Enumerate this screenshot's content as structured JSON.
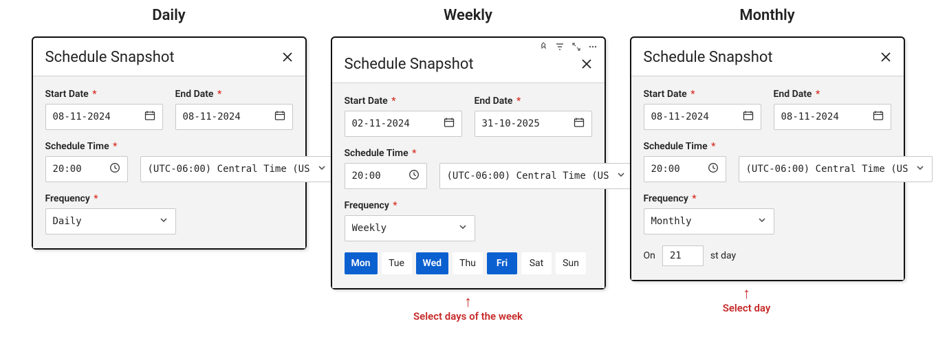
{
  "sections": {
    "daily": {
      "title": "Daily"
    },
    "weekly": {
      "title": "Weekly",
      "annotation": "Select days of the week"
    },
    "monthly": {
      "title": "Monthly",
      "annotation": "Select day"
    }
  },
  "dialog": {
    "title": "Schedule Snapshot",
    "labels": {
      "start_date": "Start Date",
      "end_date": "End Date",
      "schedule_time": "Schedule Time",
      "frequency": "Frequency",
      "required_mark": "*"
    }
  },
  "daily": {
    "start_date": "08-11-2024",
    "end_date": "08-11-2024",
    "time": "20:00",
    "tz": "(UTC-06:00) Central Time (US",
    "frequency": "Daily"
  },
  "weekly": {
    "start_date": "02-11-2024",
    "end_date": "31-10-2025",
    "time": "20:00",
    "tz": "(UTC-06:00) Central Time (US",
    "frequency": "Weekly",
    "days": {
      "mon": "Mon",
      "tue": "Tue",
      "wed": "Wed",
      "thu": "Thu",
      "fri": "Fri",
      "sat": "Sat",
      "sun": "Sun"
    },
    "selected": [
      "mon",
      "wed",
      "fri"
    ]
  },
  "monthly": {
    "start_date": "08-11-2024",
    "end_date": "08-11-2024",
    "time": "20:00",
    "tz": "(UTC-06:00) Central Time (US",
    "frequency": "Monthly",
    "on_label": "On",
    "on_day": "21",
    "on_suffix": "st day"
  }
}
